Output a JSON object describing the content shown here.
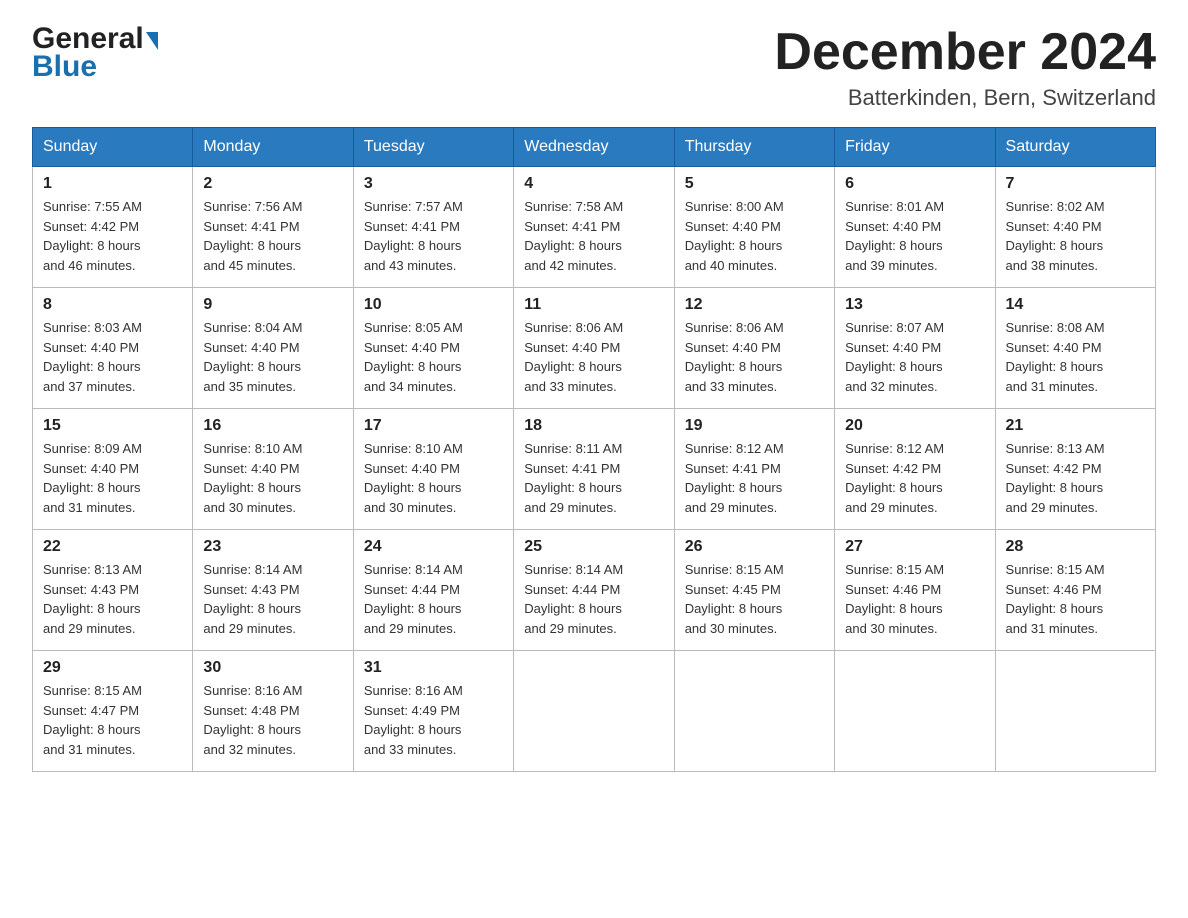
{
  "header": {
    "logo_general": "General",
    "logo_blue": "Blue",
    "title": "December 2024",
    "subtitle": "Batterkinden, Bern, Switzerland"
  },
  "days_of_week": [
    "Sunday",
    "Monday",
    "Tuesday",
    "Wednesday",
    "Thursday",
    "Friday",
    "Saturday"
  ],
  "weeks": [
    [
      {
        "day": "1",
        "sunrise": "7:55 AM",
        "sunset": "4:42 PM",
        "daylight": "8 hours and 46 minutes."
      },
      {
        "day": "2",
        "sunrise": "7:56 AM",
        "sunset": "4:41 PM",
        "daylight": "8 hours and 45 minutes."
      },
      {
        "day": "3",
        "sunrise": "7:57 AM",
        "sunset": "4:41 PM",
        "daylight": "8 hours and 43 minutes."
      },
      {
        "day": "4",
        "sunrise": "7:58 AM",
        "sunset": "4:41 PM",
        "daylight": "8 hours and 42 minutes."
      },
      {
        "day": "5",
        "sunrise": "8:00 AM",
        "sunset": "4:40 PM",
        "daylight": "8 hours and 40 minutes."
      },
      {
        "day": "6",
        "sunrise": "8:01 AM",
        "sunset": "4:40 PM",
        "daylight": "8 hours and 39 minutes."
      },
      {
        "day": "7",
        "sunrise": "8:02 AM",
        "sunset": "4:40 PM",
        "daylight": "8 hours and 38 minutes."
      }
    ],
    [
      {
        "day": "8",
        "sunrise": "8:03 AM",
        "sunset": "4:40 PM",
        "daylight": "8 hours and 37 minutes."
      },
      {
        "day": "9",
        "sunrise": "8:04 AM",
        "sunset": "4:40 PM",
        "daylight": "8 hours and 35 minutes."
      },
      {
        "day": "10",
        "sunrise": "8:05 AM",
        "sunset": "4:40 PM",
        "daylight": "8 hours and 34 minutes."
      },
      {
        "day": "11",
        "sunrise": "8:06 AM",
        "sunset": "4:40 PM",
        "daylight": "8 hours and 33 minutes."
      },
      {
        "day": "12",
        "sunrise": "8:06 AM",
        "sunset": "4:40 PM",
        "daylight": "8 hours and 33 minutes."
      },
      {
        "day": "13",
        "sunrise": "8:07 AM",
        "sunset": "4:40 PM",
        "daylight": "8 hours and 32 minutes."
      },
      {
        "day": "14",
        "sunrise": "8:08 AM",
        "sunset": "4:40 PM",
        "daylight": "8 hours and 31 minutes."
      }
    ],
    [
      {
        "day": "15",
        "sunrise": "8:09 AM",
        "sunset": "4:40 PM",
        "daylight": "8 hours and 31 minutes."
      },
      {
        "day": "16",
        "sunrise": "8:10 AM",
        "sunset": "4:40 PM",
        "daylight": "8 hours and 30 minutes."
      },
      {
        "day": "17",
        "sunrise": "8:10 AM",
        "sunset": "4:40 PM",
        "daylight": "8 hours and 30 minutes."
      },
      {
        "day": "18",
        "sunrise": "8:11 AM",
        "sunset": "4:41 PM",
        "daylight": "8 hours and 29 minutes."
      },
      {
        "day": "19",
        "sunrise": "8:12 AM",
        "sunset": "4:41 PM",
        "daylight": "8 hours and 29 minutes."
      },
      {
        "day": "20",
        "sunrise": "8:12 AM",
        "sunset": "4:42 PM",
        "daylight": "8 hours and 29 minutes."
      },
      {
        "day": "21",
        "sunrise": "8:13 AM",
        "sunset": "4:42 PM",
        "daylight": "8 hours and 29 minutes."
      }
    ],
    [
      {
        "day": "22",
        "sunrise": "8:13 AM",
        "sunset": "4:43 PM",
        "daylight": "8 hours and 29 minutes."
      },
      {
        "day": "23",
        "sunrise": "8:14 AM",
        "sunset": "4:43 PM",
        "daylight": "8 hours and 29 minutes."
      },
      {
        "day": "24",
        "sunrise": "8:14 AM",
        "sunset": "4:44 PM",
        "daylight": "8 hours and 29 minutes."
      },
      {
        "day": "25",
        "sunrise": "8:14 AM",
        "sunset": "4:44 PM",
        "daylight": "8 hours and 29 minutes."
      },
      {
        "day": "26",
        "sunrise": "8:15 AM",
        "sunset": "4:45 PM",
        "daylight": "8 hours and 30 minutes."
      },
      {
        "day": "27",
        "sunrise": "8:15 AM",
        "sunset": "4:46 PM",
        "daylight": "8 hours and 30 minutes."
      },
      {
        "day": "28",
        "sunrise": "8:15 AM",
        "sunset": "4:46 PM",
        "daylight": "8 hours and 31 minutes."
      }
    ],
    [
      {
        "day": "29",
        "sunrise": "8:15 AM",
        "sunset": "4:47 PM",
        "daylight": "8 hours and 31 minutes."
      },
      {
        "day": "30",
        "sunrise": "8:16 AM",
        "sunset": "4:48 PM",
        "daylight": "8 hours and 32 minutes."
      },
      {
        "day": "31",
        "sunrise": "8:16 AM",
        "sunset": "4:49 PM",
        "daylight": "8 hours and 33 minutes."
      },
      null,
      null,
      null,
      null
    ]
  ],
  "labels": {
    "sunrise": "Sunrise:",
    "sunset": "Sunset:",
    "daylight": "Daylight:"
  }
}
